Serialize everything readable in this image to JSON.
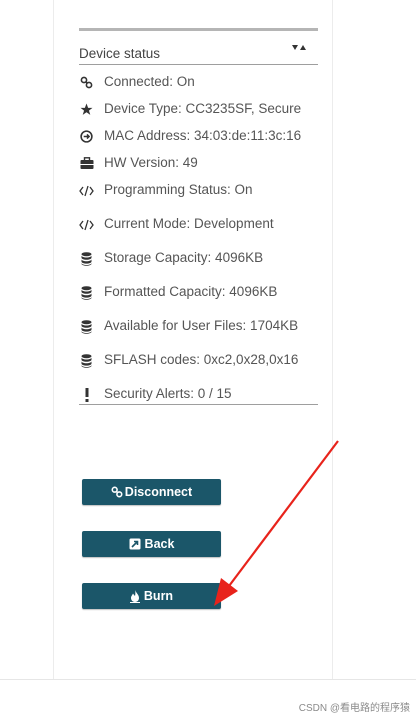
{
  "status": {
    "header_title": "Device status",
    "items": [
      {
        "icon": "link-icon",
        "text": "Connected: On"
      },
      {
        "icon": "star-icon",
        "text": "Device Type: CC3235SF, Secure"
      },
      {
        "icon": "arrow-circle-icon",
        "text": "MAC Address: 34:03:de:11:3c:16"
      },
      {
        "icon": "briefcase-icon",
        "text": "HW Version: 49"
      },
      {
        "icon": "code-icon",
        "text": "Programming Status: On"
      },
      {
        "icon": "code-icon",
        "text": "Current Mode: Development"
      },
      {
        "icon": "database-icon",
        "text": "Storage Capacity: 4096KB"
      },
      {
        "icon": "database-icon",
        "text": "Formatted Capacity: 4096KB"
      },
      {
        "icon": "database-icon",
        "text": "Available for User Files: 1704KB"
      },
      {
        "icon": "database-icon",
        "text": "SFLASH codes: 0xc2,0x28,0x16"
      },
      {
        "icon": "exclamation-icon",
        "text": "Security Alerts: 0 / 15"
      }
    ]
  },
  "buttons": {
    "disconnect": "Disconnect",
    "back": "Back",
    "burn": "Burn"
  },
  "watermark": "CSDN @看电路的程序猿",
  "colors": {
    "button_bg": "#1b5669",
    "arrow": "#e8231b"
  }
}
